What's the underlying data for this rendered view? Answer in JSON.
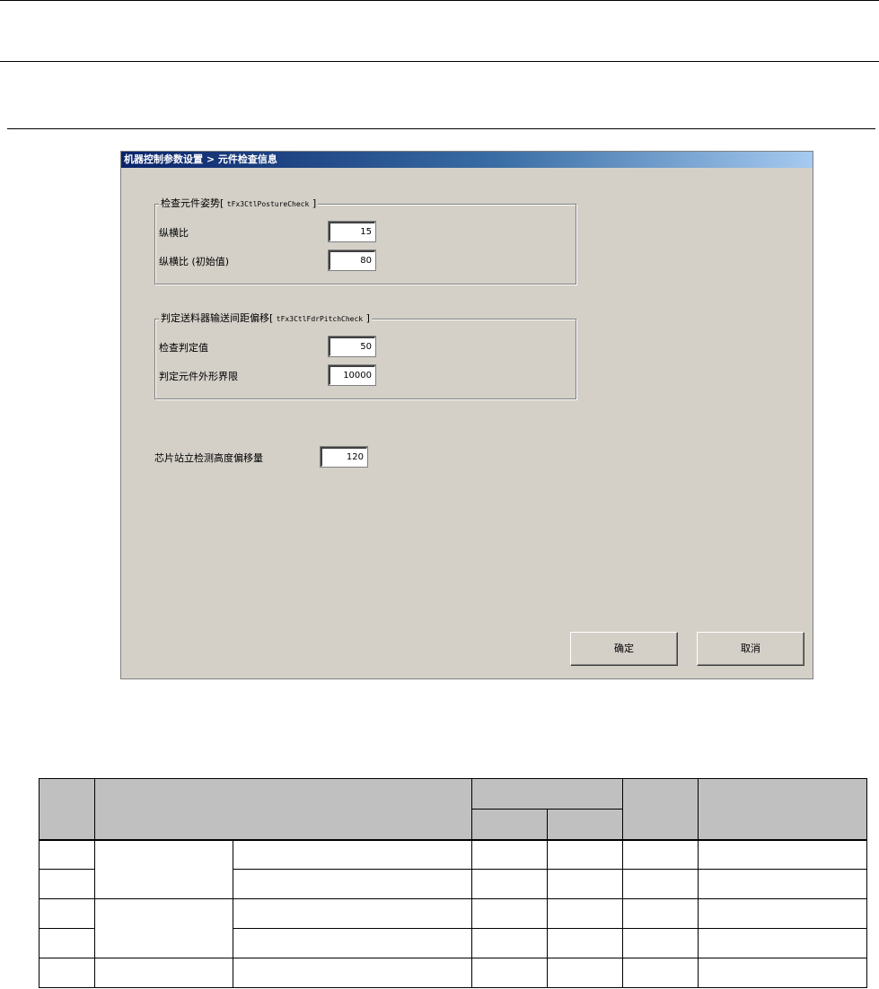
{
  "dialog": {
    "title": "机器控制参数设置 > 元件检查信息",
    "group1": {
      "title": "检查元件姿势[",
      "code": "tFx3CtlPostureCheck",
      "close": "]",
      "fields": [
        {
          "label": "纵横比",
          "value": "15"
        },
        {
          "label": "纵横比 (初始值)",
          "value": "80"
        }
      ]
    },
    "group2": {
      "title": "判定送料器输送间距偏移[",
      "code": "tFx3CtlFdrPitchCheck",
      "close": "]",
      "fields": [
        {
          "label": "检查判定值",
          "value": "50"
        },
        {
          "label": "判定元件外形界限",
          "value": "10000"
        }
      ]
    },
    "standalone": {
      "label": "芯片站立检测高度偏移量",
      "value": "120"
    },
    "buttons": {
      "ok": "确定",
      "cancel": "取消"
    }
  },
  "table": {
    "header_rows": 2,
    "body_rows": 5
  }
}
